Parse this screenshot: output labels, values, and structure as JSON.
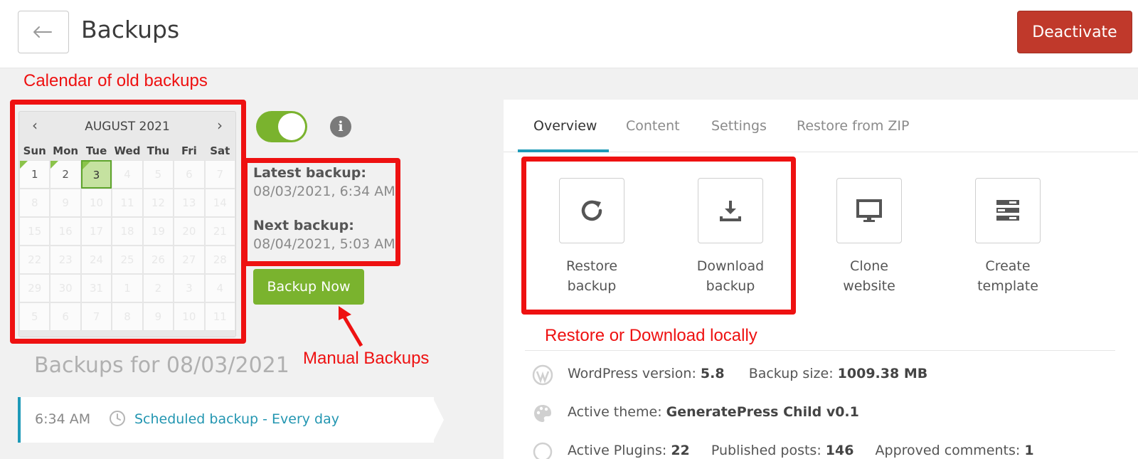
{
  "header": {
    "title": "Backups",
    "deactivate_label": "Deactivate"
  },
  "annotations": {
    "calendar": "Calendar of old backups",
    "manual": "Manual Backups",
    "restore_download": "Restore or Download locally",
    "color": "#ee1111"
  },
  "calendar": {
    "month_label": "AUGUST 2021",
    "weekdays": [
      "Sun",
      "Mon",
      "Tue",
      "Wed",
      "Thu",
      "Fri",
      "Sat"
    ],
    "cells": [
      "1",
      "2",
      "3",
      "4",
      "5",
      "6",
      "7",
      "8",
      "9",
      "10",
      "11",
      "12",
      "13",
      "14",
      "15",
      "16",
      "17",
      "18",
      "19",
      "20",
      "21",
      "22",
      "23",
      "24",
      "25",
      "26",
      "27",
      "28",
      "29",
      "30",
      "31",
      "1",
      "2",
      "3",
      "4",
      "5",
      "6",
      "7",
      "8",
      "9",
      "10",
      "11"
    ],
    "days_with_backups": [
      1,
      2,
      3
    ],
    "selected_day": 3
  },
  "backup_info": {
    "latest_label": "Latest backup:",
    "latest_value": "08/03/2021, 6:34 AM",
    "next_label": "Next backup:",
    "next_value": "08/04/2021, 5:03 AM",
    "backup_now_label": "Backup Now"
  },
  "backups_list": {
    "heading": "Backups for 08/03/2021",
    "entries": [
      {
        "time": "6:34 AM",
        "label": "Scheduled backup - Every day"
      }
    ]
  },
  "tabs": [
    "Overview",
    "Content",
    "Settings",
    "Restore from ZIP"
  ],
  "actions": [
    {
      "line1": "Restore",
      "line2": "backup",
      "icon": "restore-icon"
    },
    {
      "line1": "Download",
      "line2": "backup",
      "icon": "download-icon"
    },
    {
      "line1": "Clone",
      "line2": "website",
      "icon": "monitor-icon"
    },
    {
      "line1": "Create",
      "line2": "template",
      "icon": "template-icon"
    }
  ],
  "overview": {
    "wp_label": "WordPress version:",
    "wp_value": "5.8",
    "size_label": "Backup size:",
    "size_value": "1009.38 MB",
    "theme_label": "Active theme:",
    "theme_value": "GeneratePress Child v0.1",
    "plugins_label": "Active Plugins:",
    "plugins_value": "22",
    "posts_label": "Published posts:",
    "posts_value": "146",
    "comments_label": "Approved comments:",
    "comments_value": "1"
  },
  "colors": {
    "accent": "#1e9ab8",
    "green": "#7ab32e",
    "danger": "#c0392b"
  }
}
